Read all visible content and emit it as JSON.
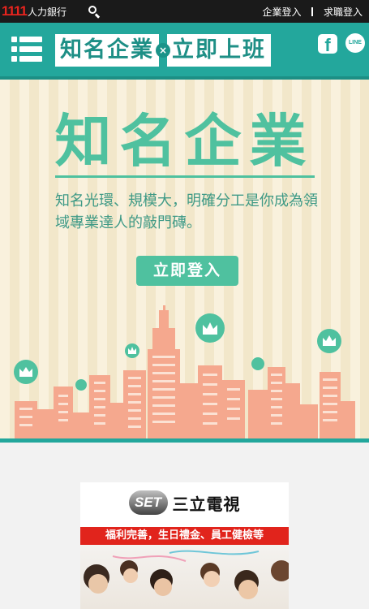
{
  "topbar": {
    "brand_number": "1111",
    "brand_name": "人力銀行",
    "links": [
      "企業登入",
      "求職登入"
    ]
  },
  "header": {
    "title_left": "知名企業",
    "title_x": "×",
    "title_right": "立即上班",
    "facebook_glyph": "f",
    "line_glyph": "LINE"
  },
  "hero": {
    "title": "知名企業",
    "description": "知名光環、規模大，明確分工是你成為領域專業達人的敲門磚。",
    "login_button": "立即登入"
  },
  "company": {
    "logo_text": "SET",
    "name": "三立電視",
    "benefit": "福利完善，生日禮金、員工健檢等"
  },
  "colors": {
    "teal": "#23a79c",
    "mint": "#4fc19f",
    "salmon": "#f5a88e",
    "red": "#e1241c"
  },
  "icons": [
    "search-icon",
    "menu-icon",
    "facebook-icon",
    "line-icon",
    "crown-icon"
  ]
}
